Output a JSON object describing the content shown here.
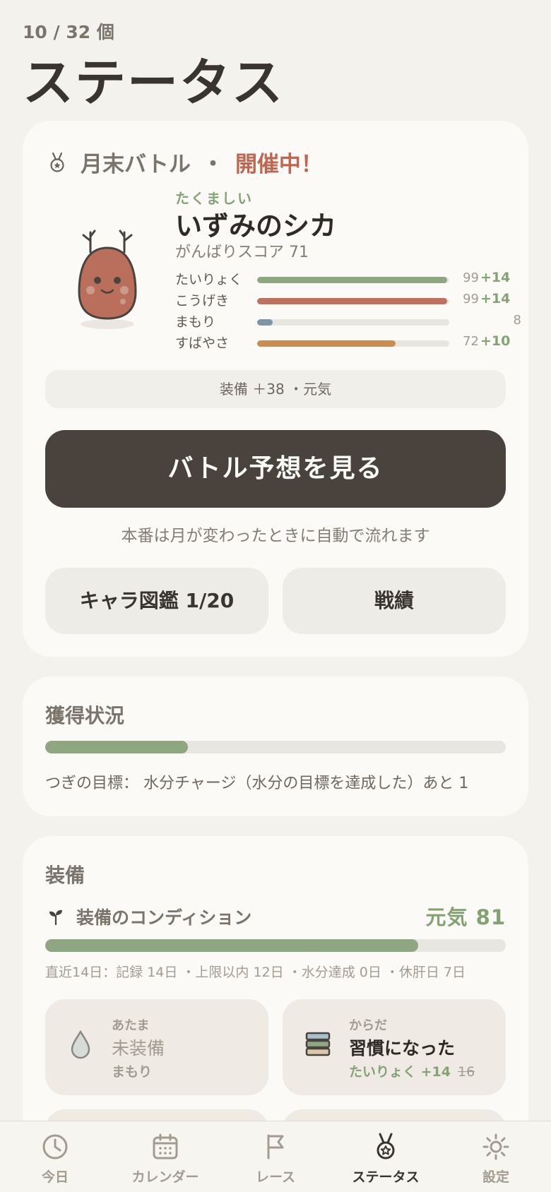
{
  "header": {
    "count": "10 / 32 個",
    "title": "ステータス"
  },
  "battle": {
    "icon": "medal-icon",
    "label": "月末バトル",
    "separator": "・",
    "status": "開催中！",
    "character": {
      "epithet": "たくましい",
      "name": "いずみのシカ",
      "score": "がんばりスコア 71"
    },
    "stats": [
      {
        "label": "たいりょく",
        "value": "99",
        "bonus": "+14",
        "level": 0.99,
        "color": "#8fa780"
      },
      {
        "label": "こうげき",
        "value": "99",
        "bonus": "+14",
        "level": 0.99,
        "color": "#c0715e"
      },
      {
        "label": "まもり",
        "value": "8",
        "bonus": "",
        "level": 0.08,
        "color": "#7b97a5"
      },
      {
        "label": "すばやさ",
        "value": "72",
        "bonus": "+10",
        "level": 0.72,
        "color": "#c98d52"
      }
    ],
    "equip_summary": "装備 ＋38 ・元気",
    "predict_button": "バトル予想を見る",
    "note": "本番は月が変わったときに自動で流れます",
    "collection_button": "キャラ図鑑 1/20",
    "record_button": "戦績"
  },
  "progress": {
    "title": "獲得状況",
    "level": 0.31,
    "next_goal": "つぎの目標： 水分チャージ（水分の目標を達成した）あと 1"
  },
  "equipment": {
    "title": "装備",
    "condition_label": "装備のコンディション",
    "condition_value": "元気 81",
    "condition_level": 0.81,
    "condition_stats": "直近14日：記録 14日 ・上限以内 12日 ・水分達成 0日 ・休肝日 7日",
    "slots": [
      {
        "title": "あたま",
        "main": "未装備",
        "sub": "まもり",
        "icon": "water-drop-icon"
      },
      {
        "title": "からだ",
        "main": "習慣になった",
        "sub": "たいりょく +14",
        "strike": "16",
        "icon": "stack-icon"
      }
    ]
  },
  "tabs": [
    {
      "label": "今日",
      "icon": "clock-icon"
    },
    {
      "label": "カレンダー",
      "icon": "calendar-icon"
    },
    {
      "label": "レース",
      "icon": "flag-icon"
    },
    {
      "label": "ステータス",
      "icon": "medal-icon",
      "active": true
    },
    {
      "label": "設定",
      "icon": "gear-icon"
    }
  ]
}
